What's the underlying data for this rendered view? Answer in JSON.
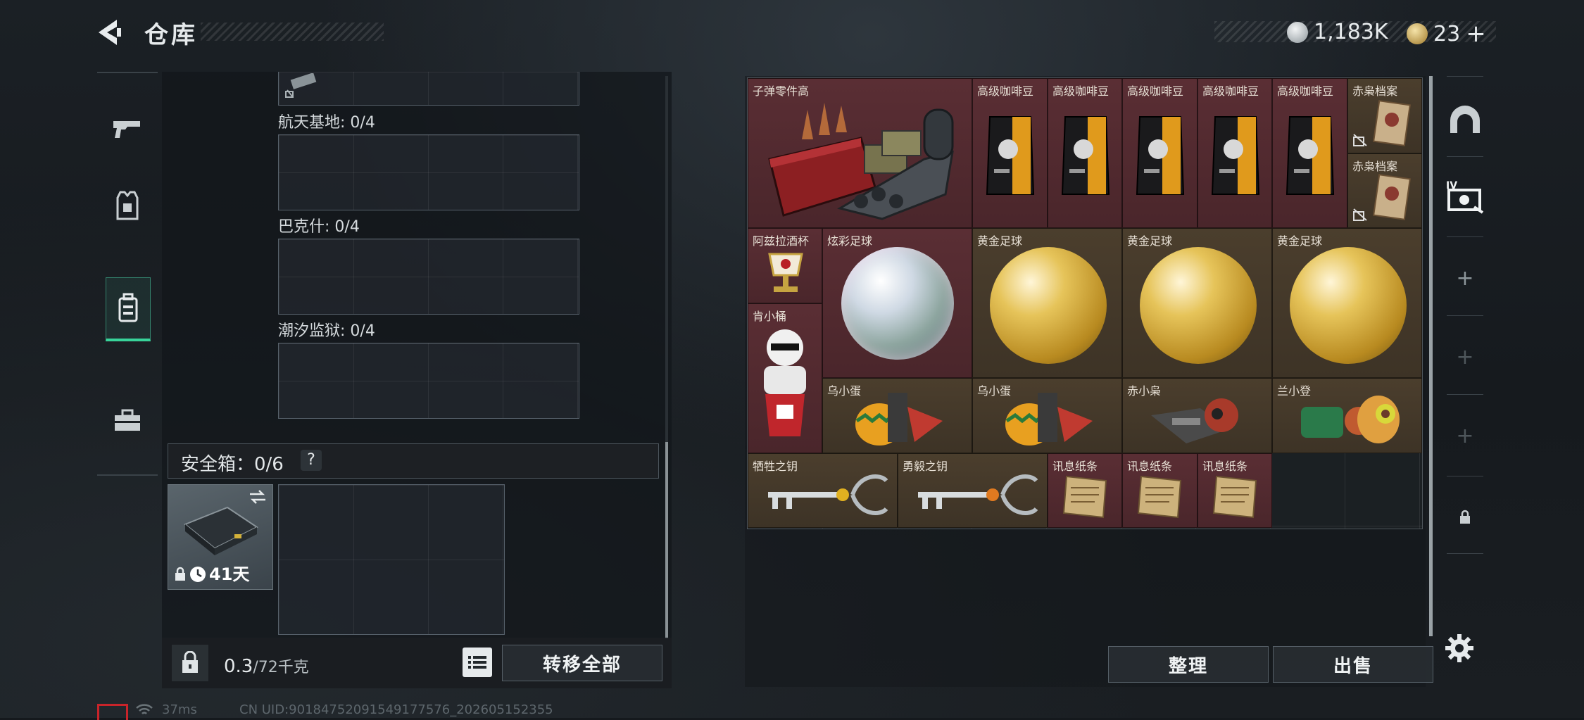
{
  "header": {
    "title": "仓库",
    "silver_amount": "1,183K",
    "gold_amount": "23",
    "gold_plus": "+"
  },
  "left_tabs": [
    {
      "icon": "pistol-icon",
      "active": false
    },
    {
      "icon": "armor-vest-icon",
      "active": false
    },
    {
      "icon": "backpack-icon",
      "active": true
    },
    {
      "icon": "toolbox-icon",
      "active": false
    }
  ],
  "collection_sections": [
    {
      "label": "航天基地: 0/4"
    },
    {
      "label": "巴克什: 0/4"
    },
    {
      "label": "潮汐监狱: 0/4"
    }
  ],
  "safe_box": {
    "label": "安全箱：0/6",
    "help": "?",
    "days": "41天"
  },
  "bottom_bar": {
    "weight_value": "0.3",
    "weight_total": "/72千克",
    "transfer_all": "转移全部"
  },
  "inventory": {
    "items": [
      {
        "name": "子弹零件高",
        "rarity": "red"
      },
      {
        "name": "高级咖啡豆",
        "rarity": "red"
      },
      {
        "name": "高级咖啡豆",
        "rarity": "red"
      },
      {
        "name": "高级咖啡豆",
        "rarity": "red"
      },
      {
        "name": "高级咖啡豆",
        "rarity": "red"
      },
      {
        "name": "高级咖啡豆",
        "rarity": "red"
      },
      {
        "name": "赤枭档案",
        "rarity": "gold"
      },
      {
        "name": "赤枭档案",
        "rarity": "gold"
      },
      {
        "name": "阿兹拉酒杯",
        "rarity": "red"
      },
      {
        "name": "炫彩足球",
        "rarity": "red"
      },
      {
        "name": "黄金足球",
        "rarity": "gold"
      },
      {
        "name": "黄金足球",
        "rarity": "gold"
      },
      {
        "name": "黄金足球",
        "rarity": "gold"
      },
      {
        "name": "肯小桶",
        "rarity": "red"
      },
      {
        "name": "乌小蛋",
        "rarity": "gold"
      },
      {
        "name": "乌小蛋",
        "rarity": "gold"
      },
      {
        "name": "赤小枭",
        "rarity": "gold"
      },
      {
        "name": "兰小登",
        "rarity": "gold"
      },
      {
        "name": "牺牲之钥",
        "rarity": "gold"
      },
      {
        "name": "勇毅之钥",
        "rarity": "gold"
      },
      {
        "name": "讯息纸条",
        "rarity": "red"
      },
      {
        "name": "讯息纸条",
        "rarity": "red"
      },
      {
        "name": "讯息纸条",
        "rarity": "red"
      }
    ],
    "sort_button": "整理",
    "sell_button": "出售"
  },
  "right_rail": [
    "dome-icon",
    "camera-lv4-icon",
    "plus-icon",
    "plus-icon",
    "plus-icon",
    "lock-icon"
  ],
  "footer": {
    "ping": "37ms",
    "uid": "CN UID:9018475209154917757​6_202605152355"
  },
  "colors": {
    "accent": "#38d49a",
    "rarity_red": "#5a2e34",
    "rarity_gold": "#4b3e2d"
  }
}
